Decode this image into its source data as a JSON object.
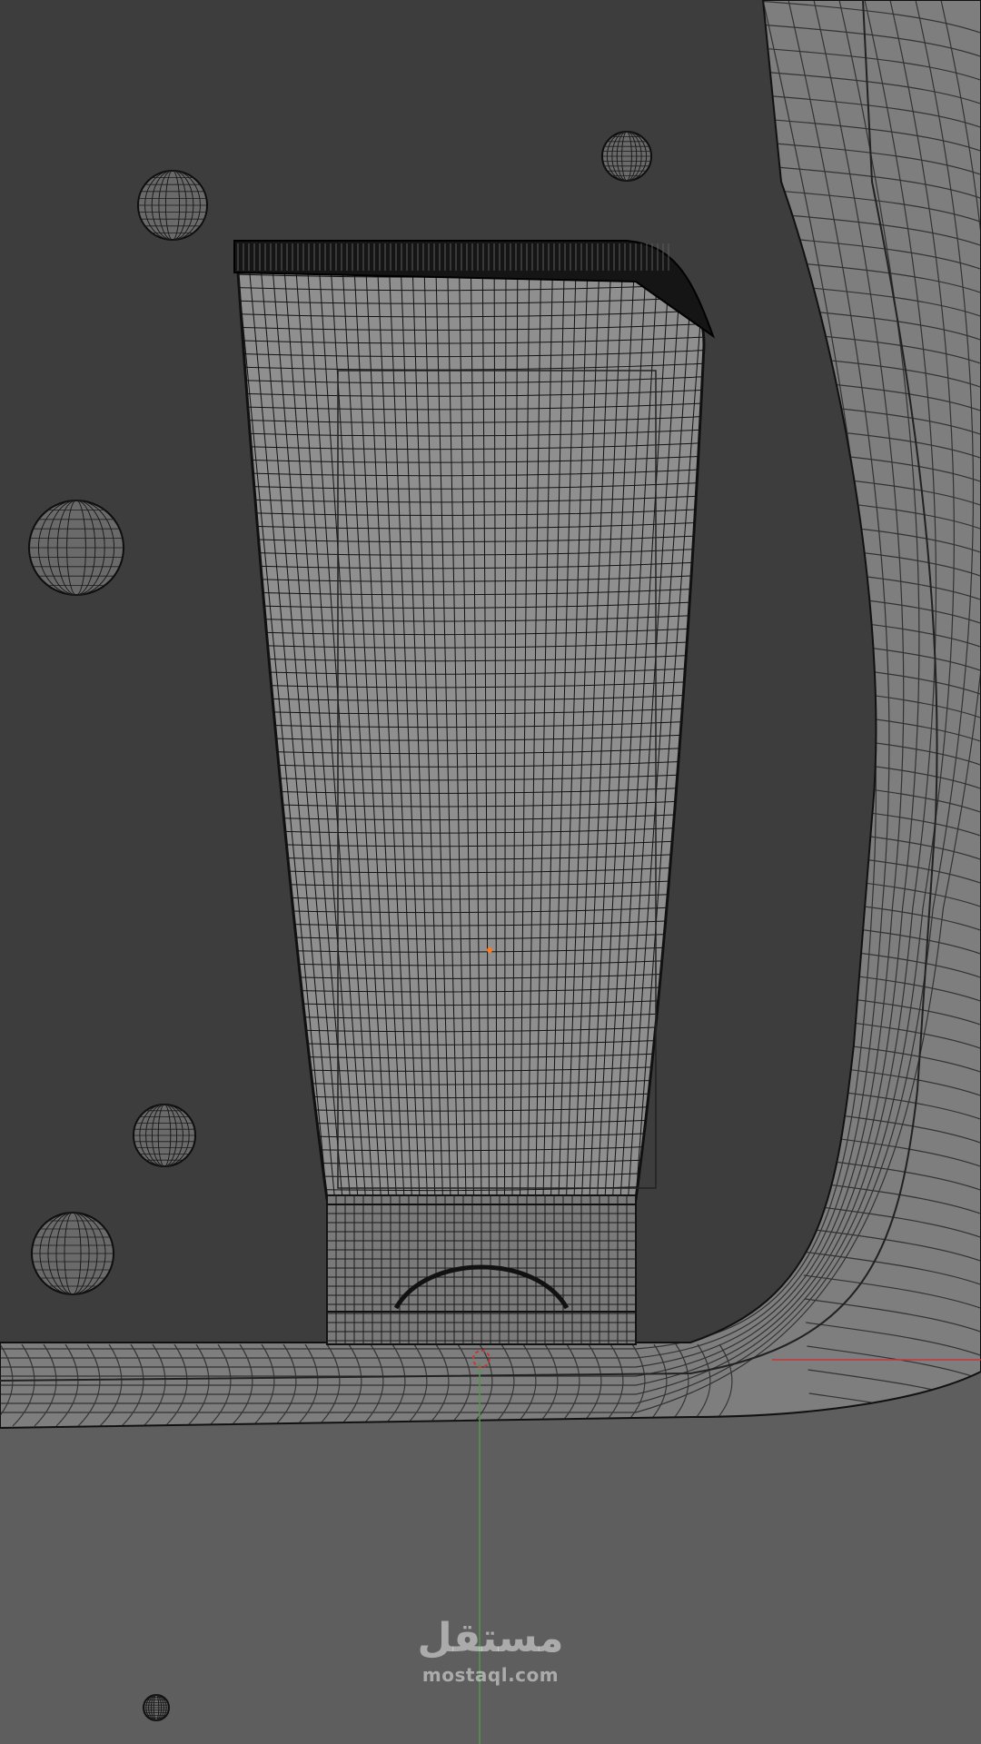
{
  "viewport": {
    "background_color": "#3d3d3d",
    "floor_color": "#5e5e5e",
    "wire_color": "#141414",
    "surface_color": "#8a8a8a",
    "axis_x_color": "#c23a3a",
    "axis_y_color": "#4d9a4d",
    "origin_color": "#ff7a1a"
  },
  "scene": {
    "objects": [
      {
        "name": "tube-body",
        "kind": "tube"
      },
      {
        "name": "tube-cap",
        "kind": "cap"
      },
      {
        "name": "curved-backdrop",
        "kind": "sweep"
      },
      {
        "name": "sphere",
        "kind": "sphere"
      }
    ]
  },
  "watermark": {
    "logo": "مستقل",
    "url": "mostaql.com"
  }
}
